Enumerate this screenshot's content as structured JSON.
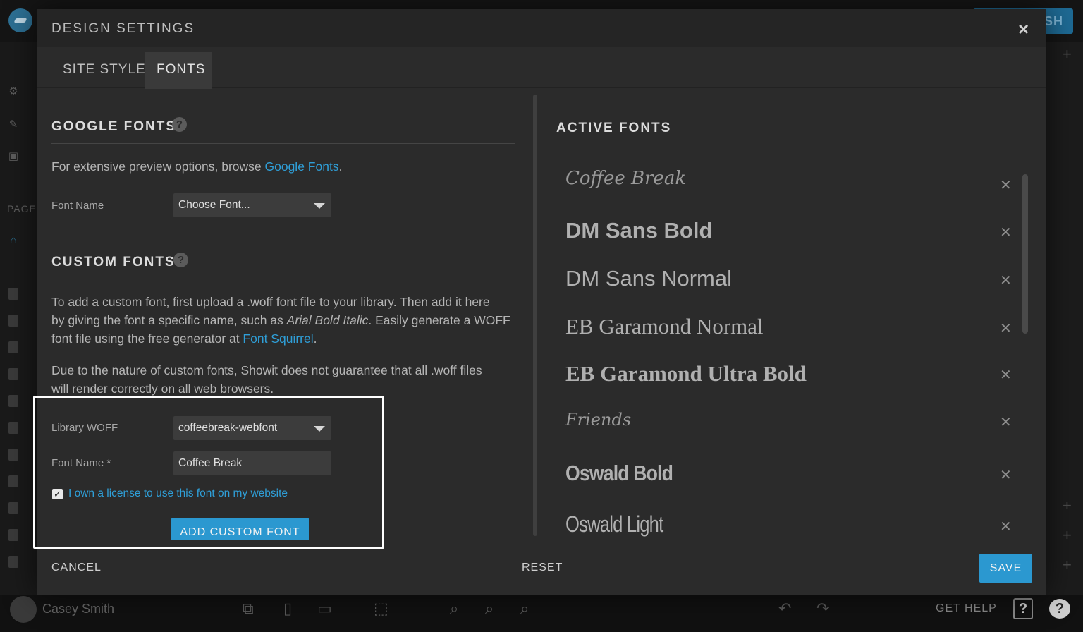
{
  "background": {
    "publish_partial": "SH",
    "user_name": "Casey Smith",
    "sidebar_section": "PAGE",
    "get_help_label": "GET HELP"
  },
  "modal": {
    "title": "DESIGN SETTINGS",
    "close_glyph": "×",
    "tabs": [
      {
        "label": "SITE STYLE",
        "active": false
      },
      {
        "label": "FONTS",
        "active": true
      }
    ]
  },
  "google_fonts": {
    "title": "GOOGLE FONTS",
    "help": "?",
    "intro_prefix": "For extensive preview options, browse ",
    "intro_link": "Google Fonts",
    "intro_suffix": ".",
    "font_name_label": "Font Name",
    "font_select_value": "Choose Font..."
  },
  "custom_fonts": {
    "title": "CUSTOM FONTS",
    "help": "?",
    "desc1_line1": "To add a custom font, first upload a .woff font file to your library. Then add it here",
    "desc1_line2_prefix": "by giving the font a specific name, such as ",
    "desc1_line2_italic": "Arial Bold Italic",
    "desc1_line2_suffix": ". Easily generate a WOFF",
    "desc1_line3_prefix": "font file using the free generator at ",
    "desc1_line3_link": "Font Squirrel",
    "desc1_line3_suffix": ".",
    "desc2_line1": "Due to the nature of custom fonts, Showit does not guarantee that all .woff files",
    "desc2_line2": "will render correctly on all web browsers.",
    "library_woff_label": "Library WOFF",
    "library_woff_value": "coffeebreak-webfont",
    "font_name_label": "Font Name *",
    "font_name_value": "Coffee Break",
    "license_label": "I own a license to use this font on my website",
    "license_checked": "✓",
    "add_button": "ADD CUSTOM FONT"
  },
  "active_fonts": {
    "title": "ACTIVE FONTS",
    "remove_glyph": "✕",
    "items": [
      {
        "name": "Coffee Break"
      },
      {
        "name": "DM Sans Bold"
      },
      {
        "name": "DM Sans Normal"
      },
      {
        "name": "EB Garamond Normal"
      },
      {
        "name": "EB Garamond Ultra Bold"
      },
      {
        "name": "Friends"
      },
      {
        "name": "Oswald Bold"
      },
      {
        "name": "Oswald Light"
      }
    ]
  },
  "footer": {
    "cancel": "CANCEL",
    "reset": "RESET",
    "save": "SAVE"
  },
  "colors": {
    "accent": "#2b98d0",
    "link": "#2f9fd8",
    "modal_bg": "#2b2b2b"
  }
}
